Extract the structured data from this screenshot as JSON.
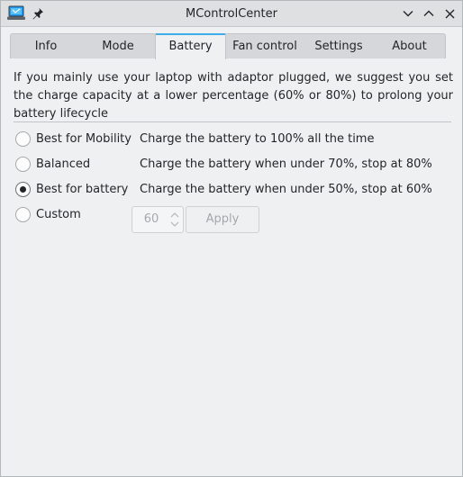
{
  "window": {
    "title": "MControlCenter"
  },
  "tabs": [
    {
      "label": "Info"
    },
    {
      "label": "Mode"
    },
    {
      "label": "Battery"
    },
    {
      "label": "Fan control"
    },
    {
      "label": "Settings"
    },
    {
      "label": "About"
    }
  ],
  "battery": {
    "intro": "If you mainly use your laptop with adaptor plugged, we suggest you set the charge capacity at a lower percentage (60% or 80%) to prolong your battery lifecycle",
    "options": [
      {
        "label": "Best for Mobility",
        "description": "Charge the battery to 100% all the time",
        "checked": false
      },
      {
        "label": "Balanced",
        "description": "Charge the battery when under 70%, stop at 80%",
        "checked": false
      },
      {
        "label": "Best for battery",
        "description": "Charge the battery when under 50%, stop at 60%",
        "checked": true
      },
      {
        "label": "Custom",
        "description": "",
        "checked": false
      }
    ],
    "custom_value": "60",
    "apply_label": "Apply"
  },
  "colors": {
    "accent": "#3daee9",
    "background": "#eff0f1",
    "text": "#232629",
    "disabled_text": "#a5a8ab"
  }
}
